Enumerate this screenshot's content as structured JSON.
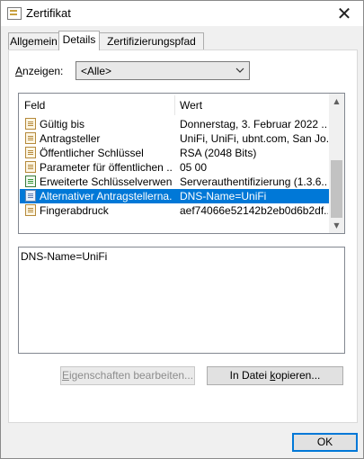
{
  "window": {
    "title": "Zertifikat",
    "close_glyph": "✕"
  },
  "tabs": [
    {
      "label": "Allgemein"
    },
    {
      "label": "Details"
    },
    {
      "label": "Zertifizierungspfad"
    }
  ],
  "show": {
    "label_prefix": "A",
    "label_rest": "nzeigen:",
    "selected": "<Alle>"
  },
  "list": {
    "columns": {
      "field": "Feld",
      "value": "Wert"
    },
    "rows": [
      {
        "field": "Gültig bis",
        "value": "Donnerstag, 3. Februar 2022 ...",
        "icon": "certificate-field-icon"
      },
      {
        "field": "Antragsteller",
        "value": "UniFi, UniFi, ubnt.com, San Jo...",
        "icon": "certificate-field-icon"
      },
      {
        "field": "Öffentlicher Schlüssel",
        "value": "RSA (2048 Bits)",
        "icon": "certificate-field-icon"
      },
      {
        "field": "Parameter für öffentlichen ...",
        "value": "05 00",
        "icon": "certificate-field-icon"
      },
      {
        "field": "Erweiterte Schlüsselverwen...",
        "value": "Serverauthentifizierung (1.3.6....",
        "icon": "extension-field-icon"
      },
      {
        "field": "Alternativer Antragstellerna...",
        "value": "DNS-Name=UniFi",
        "icon": "extension-field-icon"
      },
      {
        "field": "Fingerabdruck",
        "value": "aef74066e52142b2eb0d6b2df...",
        "icon": "certificate-field-icon"
      }
    ],
    "selected_index": 5
  },
  "detail": {
    "text": "DNS-Name=UniFi"
  },
  "buttons": {
    "edit_prefix": "E",
    "edit_rest": "igenschaften bearbeiten...",
    "copy_prefix": "In Datei ",
    "copy_ul": "k",
    "copy_rest": "opieren...",
    "ok": "OK"
  },
  "colors": {
    "selection": "#0078d7",
    "panel": "#ffffff",
    "window": "#f0f0f0"
  }
}
